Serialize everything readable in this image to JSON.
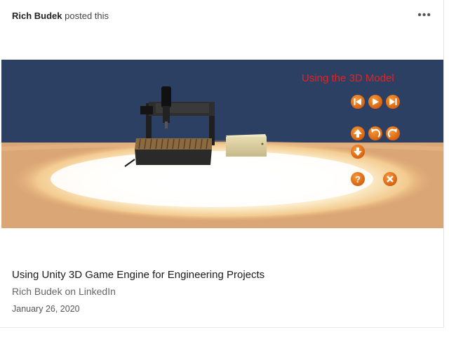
{
  "post": {
    "author": "Rich Budek",
    "action": "posted this",
    "more_label": "•••"
  },
  "media": {
    "overlay_title": "Using the 3D Model",
    "controls": {
      "row1": [
        "skip-back-icon",
        "play-icon",
        "skip-forward-icon"
      ],
      "row2": [
        "arrow-up-icon",
        "rotate-left-icon",
        "rotate-right-icon"
      ],
      "row3": [
        "arrow-down-icon"
      ],
      "row4": [
        "help-icon",
        "close-icon"
      ]
    },
    "colors": {
      "sky": "#2c4064",
      "floor": "#d9a572",
      "button": "#e06a12",
      "overlay_text": "#e02424"
    }
  },
  "article": {
    "title": "Using Unity 3D Game Engine for Engineering Projects",
    "source": "Rich Budek on LinkedIn",
    "date": "January 26, 2020"
  }
}
